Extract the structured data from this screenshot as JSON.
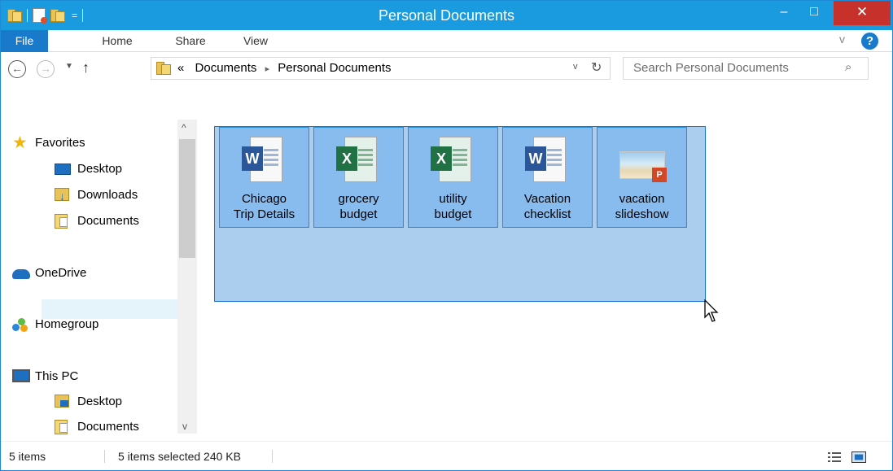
{
  "window": {
    "title": "Personal Documents",
    "minimize_glyph": "–",
    "maximize_glyph": "□",
    "close_glyph": "✕"
  },
  "quick_access": {
    "dropdown_glyph": "="
  },
  "ribbon": {
    "tabs": [
      "File",
      "Home",
      "Share",
      "View"
    ],
    "collapse_glyph": "v",
    "help_glyph": "?"
  },
  "address": {
    "overflow_glyph": "«",
    "crumbs": [
      "Documents",
      "Personal Documents"
    ],
    "separator_glyph": "▸",
    "dropdown_glyph": "v",
    "refresh_glyph": "↻"
  },
  "search": {
    "placeholder": "Search Personal Documents",
    "icon_glyph": "⌕"
  },
  "navigation": {
    "favorites": {
      "label": "Favorites",
      "icon": "star-icon"
    },
    "favorite_items": [
      {
        "label": "Desktop",
        "icon": "desktop-icon"
      },
      {
        "label": "Downloads",
        "icon": "downloads-folder-icon"
      },
      {
        "label": "Documents",
        "icon": "documents-folder-icon"
      }
    ],
    "onedrive": {
      "label": "OneDrive",
      "icon": "onedrive-icon"
    },
    "homegroup": {
      "label": "Homegroup",
      "icon": "homegroup-icon"
    },
    "this_pc": {
      "label": "This PC",
      "icon": "computer-icon"
    },
    "pc_items": [
      {
        "label": "Desktop",
        "icon": "desktop-folder-icon"
      },
      {
        "label": "Documents",
        "icon": "documents-folder-icon",
        "selected": true
      }
    ],
    "scroll_up_glyph": "^",
    "scroll_down_glyph": "v"
  },
  "files": [
    {
      "name_lines": [
        "Chicago",
        "Trip Details"
      ],
      "type": "word",
      "badge": "W",
      "selected": true
    },
    {
      "name_lines": [
        "grocery",
        "budget"
      ],
      "type": "excel",
      "badge": "X",
      "selected": true
    },
    {
      "name_lines": [
        "utility",
        "budget"
      ],
      "type": "excel",
      "badge": "X",
      "selected": true
    },
    {
      "name_lines": [
        "Vacation",
        "checklist"
      ],
      "type": "word",
      "badge": "W",
      "selected": true
    },
    {
      "name_lines": [
        "vacation",
        "slideshow"
      ],
      "type": "powerpoint",
      "badge": "P",
      "selected": true
    }
  ],
  "status": {
    "count": "5 items",
    "selection": "5 items selected  240 KB"
  },
  "colors": {
    "title_bar": "#1a9be0",
    "file_tab": "#1979ca",
    "close_button": "#c7312b",
    "selection": "#66aaee",
    "word": "#2b579a",
    "excel": "#207245",
    "powerpoint": "#d24726"
  }
}
